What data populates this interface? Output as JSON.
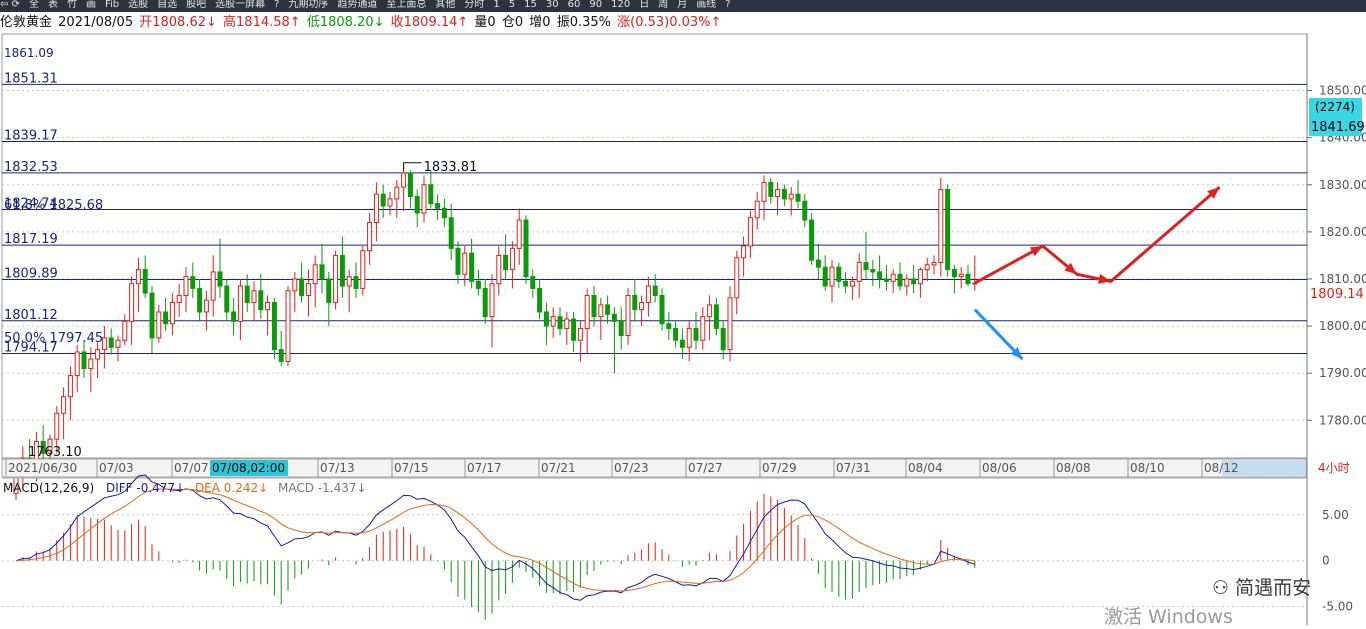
{
  "toolbar": {
    "items": [
      "⇦ ⟳",
      "全",
      "表",
      "竹",
      "画",
      "Fib",
      "选股",
      "自选",
      "股吧",
      "选股一屏幕",
      "?",
      "九期功序",
      "趋势通道",
      "至上面总",
      "其他",
      "分时",
      "1",
      "5",
      "15",
      "30",
      "60",
      "90",
      "120",
      "日",
      "周",
      "月",
      "画线",
      "?"
    ]
  },
  "info": {
    "symbol": "伦敦黄金",
    "date": "2021/08/05",
    "open": "开1808.62↓",
    "high": "高1814.58↑",
    "low": "低1808.20↓",
    "close": "收1809.14↑",
    "volume": "量0",
    "position": "仓0",
    "increase": "增0",
    "amplitude": "振0.35%",
    "change": "涨(0.53)0.03%↑"
  },
  "right_panel": {
    "count_label": "(2274)",
    "last_price_label": "1841.69",
    "current_price_label": "1809.14",
    "period_label": "4小时"
  },
  "chart_data": {
    "type": "candlestick",
    "instrument": "伦敦黄金",
    "timeframe": "4小时",
    "y_axis": {
      "ticks": [
        1780,
        1790,
        1800,
        1810,
        1820,
        1830,
        1840,
        1850
      ],
      "labels": [
        "1780.00",
        "1790.00",
        "1800.00",
        "1810.00",
        "1820.00",
        "1830.00",
        "1840.00",
        "1850.00"
      ],
      "ylim": [
        1772,
        1862
      ]
    },
    "x_axis": {
      "labels": [
        "2021/06/30",
        "07/03",
        "07/07",
        "07/13",
        "07/15",
        "07/17",
        "07/21",
        "07/23",
        "07/27",
        "07/29",
        "07/31",
        "08/04",
        "08/06",
        "08/08",
        "08/10",
        "08/12"
      ],
      "highlight": "07/08,02:00"
    },
    "top_cut_label": "1861.09",
    "horizontal_levels": [
      {
        "value": 1851.31,
        "label": "1851.31"
      },
      {
        "value": 1839.17,
        "label": "1839.17"
      },
      {
        "value": 1832.53,
        "label": "1832.53"
      },
      {
        "value": 1824.74,
        "label": "1824.74"
      },
      {
        "value": 1817.19,
        "label": "1817.19"
      },
      {
        "value": 1809.89,
        "label": "1809.89"
      },
      {
        "value": 1801.12,
        "label": "1801.12"
      },
      {
        "value": 1794.17,
        "label": "1794.17"
      }
    ],
    "fib_labels": [
      {
        "value": 1825.68,
        "label": "61.8% 1825.68"
      },
      {
        "value": 1797.45,
        "label": "50.0% 1797.45"
      }
    ],
    "annotations": [
      {
        "label": "1833.81",
        "value": 1833.81
      },
      {
        "label": "1763.10",
        "value": 1763.1
      }
    ],
    "candles": [
      [
        1764.5,
        1763.1,
        1770.0,
        1769.0
      ],
      [
        1769.0,
        1766.0,
        1774.5,
        1772.0
      ],
      [
        1772.0,
        1768.5,
        1776.0,
        1770.0
      ],
      [
        1770.0,
        1767.0,
        1777.5,
        1775.5
      ],
      [
        1775.5,
        1771.0,
        1779.0,
        1773.0
      ],
      [
        1773.0,
        1770.0,
        1777.0,
        1776.0
      ],
      [
        1776.0,
        1773.0,
        1783.0,
        1781.5
      ],
      [
        1781.5,
        1776.0,
        1787.0,
        1785.0
      ],
      [
        1785.0,
        1780.0,
        1791.5,
        1789.5
      ],
      [
        1789.5,
        1786.0,
        1796.0,
        1794.5
      ],
      [
        1794.5,
        1789.0,
        1797.0,
        1791.0
      ],
      [
        1791.0,
        1786.0,
        1795.5,
        1793.0
      ],
      [
        1793.0,
        1789.0,
        1796.5,
        1795.0
      ],
      [
        1795.0,
        1791.0,
        1800.0,
        1797.5
      ],
      [
        1797.5,
        1794.0,
        1799.5,
        1795.5
      ],
      [
        1795.5,
        1792.5,
        1798.0,
        1797.0
      ],
      [
        1797.0,
        1796.0,
        1802.5,
        1801.0
      ],
      [
        1801.0,
        1796.0,
        1810.5,
        1809.0
      ],
      [
        1809.0,
        1803.0,
        1814.5,
        1812.0
      ],
      [
        1812.0,
        1806.0,
        1815.0,
        1807.0
      ],
      [
        1807.0,
        1794.0,
        1808.5,
        1797.5
      ],
      [
        1797.5,
        1796.5,
        1804.5,
        1803.0
      ],
      [
        1803.0,
        1799.0,
        1806.0,
        1800.5
      ],
      [
        1800.5,
        1798.0,
        1807.0,
        1805.0
      ],
      [
        1805.0,
        1802.0,
        1809.0,
        1806.5
      ],
      [
        1806.5,
        1803.0,
        1812.5,
        1810.5
      ],
      [
        1810.5,
        1806.0,
        1813.5,
        1808.0
      ],
      [
        1808.0,
        1801.0,
        1810.0,
        1803.0
      ],
      [
        1803.0,
        1799.0,
        1807.5,
        1805.5
      ],
      [
        1805.5,
        1802.0,
        1815.0,
        1811.5
      ],
      [
        1811.5,
        1806.0,
        1818.5,
        1808.5
      ],
      [
        1808.5,
        1801.0,
        1810.0,
        1803.0
      ],
      [
        1803.0,
        1798.0,
        1806.0,
        1801.0
      ],
      [
        1801.0,
        1797.0,
        1810.0,
        1808.5
      ],
      [
        1808.5,
        1803.0,
        1811.0,
        1805.0
      ],
      [
        1805.0,
        1801.0,
        1809.5,
        1807.5
      ],
      [
        1807.5,
        1801.5,
        1811.0,
        1803.5
      ],
      [
        1803.5,
        1798.0,
        1806.5,
        1805.0
      ],
      [
        1805.0,
        1793.0,
        1806.0,
        1795.0
      ],
      [
        1795.0,
        1791.5,
        1799.0,
        1792.5
      ],
      [
        1792.5,
        1791.5,
        1808.5,
        1807.5
      ],
      [
        1807.5,
        1803.0,
        1811.5,
        1810.0
      ],
      [
        1810.0,
        1805.0,
        1813.5,
        1806.5
      ],
      [
        1806.5,
        1802.0,
        1812.0,
        1809.0
      ],
      [
        1809.0,
        1804.0,
        1815.0,
        1813.0
      ],
      [
        1813.0,
        1807.0,
        1817.5,
        1810.0
      ],
      [
        1810.0,
        1800.0,
        1811.5,
        1805.0
      ],
      [
        1805.0,
        1803.5,
        1816.0,
        1815.0
      ],
      [
        1815.0,
        1806.0,
        1819.0,
        1808.5
      ],
      [
        1808.5,
        1803.0,
        1812.0,
        1810.5
      ],
      [
        1810.5,
        1806.0,
        1813.5,
        1808.0
      ],
      [
        1808.0,
        1806.5,
        1817.0,
        1816.0
      ],
      [
        1816.0,
        1813.0,
        1824.0,
        1822.0
      ],
      [
        1822.0,
        1818.0,
        1830.5,
        1828.0
      ],
      [
        1828.0,
        1823.0,
        1830.0,
        1825.5
      ],
      [
        1825.5,
        1823.5,
        1828.5,
        1827.0
      ],
      [
        1827.0,
        1823.0,
        1831.0,
        1829.5
      ],
      [
        1829.5,
        1824.5,
        1833.81,
        1832.5
      ],
      [
        1832.5,
        1825.0,
        1833.0,
        1827.5
      ],
      [
        1827.5,
        1821.0,
        1829.0,
        1824.0
      ],
      [
        1824.0,
        1822.0,
        1832.0,
        1830.0
      ],
      [
        1830.0,
        1825.0,
        1833.0,
        1826.0
      ],
      [
        1826.0,
        1822.5,
        1828.0,
        1825.0
      ],
      [
        1825.0,
        1821.0,
        1827.0,
        1823.0
      ],
      [
        1823.0,
        1814.0,
        1826.0,
        1816.5
      ],
      [
        1816.5,
        1809.0,
        1818.0,
        1811.0
      ],
      [
        1811.0,
        1808.5,
        1817.0,
        1815.5
      ],
      [
        1815.5,
        1808.0,
        1818.5,
        1809.5
      ],
      [
        1809.5,
        1806.5,
        1812.0,
        1808.0
      ],
      [
        1808.0,
        1800.5,
        1810.0,
        1802.0
      ],
      [
        1802.0,
        1795.5,
        1811.0,
        1809.0
      ],
      [
        1809.0,
        1806.5,
        1817.0,
        1815.0
      ],
      [
        1815.0,
        1810.0,
        1819.5,
        1812.0
      ],
      [
        1812.0,
        1808.0,
        1818.0,
        1816.5
      ],
      [
        1816.5,
        1813.0,
        1825.0,
        1822.5
      ],
      [
        1822.5,
        1809.0,
        1823.5,
        1810.5
      ],
      [
        1810.5,
        1806.0,
        1812.0,
        1808.0
      ],
      [
        1808.0,
        1801.5,
        1810.0,
        1803.0
      ],
      [
        1803.0,
        1796.0,
        1805.0,
        1800.0
      ],
      [
        1800.0,
        1797.5,
        1804.0,
        1802.0
      ],
      [
        1802.0,
        1798.0,
        1804.0,
        1799.5
      ],
      [
        1799.5,
        1796.0,
        1803.0,
        1801.5
      ],
      [
        1801.5,
        1794.5,
        1803.0,
        1797.0
      ],
      [
        1797.0,
        1792.5,
        1801.0,
        1799.5
      ],
      [
        1799.5,
        1794.0,
        1808.0,
        1806.5
      ],
      [
        1806.5,
        1800.0,
        1808.5,
        1802.0
      ],
      [
        1802.0,
        1797.0,
        1806.0,
        1804.5
      ],
      [
        1804.5,
        1800.5,
        1806.5,
        1802.5
      ],
      [
        1802.5,
        1790.0,
        1804.0,
        1801.0
      ],
      [
        1801.0,
        1795.0,
        1804.0,
        1798.0
      ],
      [
        1798.0,
        1796.0,
        1808.0,
        1806.5
      ],
      [
        1806.5,
        1801.0,
        1810.0,
        1803.5
      ],
      [
        1803.5,
        1800.0,
        1806.5,
        1805.0
      ],
      [
        1805.0,
        1802.0,
        1810.5,
        1808.5
      ],
      [
        1808.5,
        1805.0,
        1811.0,
        1806.5
      ],
      [
        1806.5,
        1799.0,
        1808.0,
        1800.5
      ],
      [
        1800.5,
        1797.0,
        1803.0,
        1799.5
      ],
      [
        1799.5,
        1795.5,
        1801.0,
        1797.0
      ],
      [
        1797.0,
        1793.0,
        1799.5,
        1795.5
      ],
      [
        1795.5,
        1792.5,
        1801.0,
        1799.5
      ],
      [
        1799.5,
        1795.0,
        1803.0,
        1797.0
      ],
      [
        1797.0,
        1795.0,
        1804.0,
        1802.0
      ],
      [
        1802.0,
        1797.0,
        1806.5,
        1804.5
      ],
      [
        1804.5,
        1798.0,
        1806.0,
        1799.5
      ],
      [
        1799.5,
        1793.0,
        1801.0,
        1795.0
      ],
      [
        1795.0,
        1792.5,
        1808.5,
        1806.0
      ],
      [
        1806.0,
        1802.5,
        1816.0,
        1814.5
      ],
      [
        1814.5,
        1810.5,
        1819.0,
        1817.0
      ],
      [
        1817.0,
        1814.5,
        1824.5,
        1823.0
      ],
      [
        1823.0,
        1820.5,
        1828.5,
        1826.5
      ],
      [
        1826.5,
        1822.5,
        1832.0,
        1830.5
      ],
      [
        1830.5,
        1826.0,
        1831.5,
        1827.5
      ],
      [
        1827.5,
        1823.5,
        1830.5,
        1829.0
      ],
      [
        1829.0,
        1825.5,
        1830.0,
        1827.0
      ],
      [
        1827.0,
        1823.5,
        1829.5,
        1828.0
      ],
      [
        1828.0,
        1825.0,
        1831.0,
        1826.5
      ],
      [
        1826.5,
        1821.0,
        1828.0,
        1822.5
      ],
      [
        1822.5,
        1813.0,
        1824.0,
        1814.0
      ],
      [
        1814.0,
        1810.0,
        1817.5,
        1812.5
      ],
      [
        1812.5,
        1807.5,
        1815.0,
        1808.5
      ],
      [
        1808.5,
        1805.0,
        1814.0,
        1812.5
      ],
      [
        1812.5,
        1808.0,
        1813.5,
        1809.5
      ],
      [
        1809.5,
        1807.0,
        1811.5,
        1808.5
      ],
      [
        1808.5,
        1805.5,
        1810.5,
        1809.5
      ],
      [
        1809.5,
        1806.0,
        1815.5,
        1813.5
      ],
      [
        1813.5,
        1810.0,
        1820.0,
        1812.0
      ],
      [
        1812.0,
        1808.5,
        1814.0,
        1811.5
      ],
      [
        1811.5,
        1808.0,
        1815.0,
        1810.0
      ],
      [
        1810.0,
        1807.5,
        1813.0,
        1809.5
      ],
      [
        1809.5,
        1807.0,
        1812.0,
        1811.0
      ],
      [
        1811.0,
        1807.5,
        1813.5,
        1808.5
      ],
      [
        1808.5,
        1806.5,
        1811.0,
        1810.0
      ],
      [
        1810.0,
        1807.0,
        1813.0,
        1809.0
      ],
      [
        1809.0,
        1806.0,
        1812.5,
        1812.0
      ],
      [
        1812.0,
        1809.5,
        1814.5,
        1813.0
      ],
      [
        1813.0,
        1811.0,
        1815.0,
        1813.5
      ],
      [
        1813.5,
        1810.5,
        1831.5,
        1829.0
      ],
      [
        1829.0,
        1810.5,
        1830.0,
        1812.0
      ],
      [
        1812.0,
        1807.0,
        1813.0,
        1810.5
      ],
      [
        1810.5,
        1808.0,
        1812.5,
        1811.0
      ],
      [
        1811.0,
        1808.5,
        1813.0,
        1809.0
      ],
      [
        1809.0,
        1807.5,
        1815.0,
        1809.14
      ]
    ],
    "projection": {
      "red_path": [
        [
          0,
          1809.14
        ],
        [
          10,
          1817.0
        ],
        [
          15,
          1811.0
        ],
        [
          20,
          1809.5
        ],
        [
          36,
          1829.5
        ]
      ],
      "blue_path": [
        [
          0,
          1803.5
        ],
        [
          7,
          1793.0
        ]
      ]
    },
    "macd": {
      "title": "MACD(12,26,9)",
      "diff_label": "DIFF -0.477↓",
      "dea_label": "DEA 0.242↓",
      "macd_label": "MACD -1.437↓",
      "y_ticks": [
        5,
        0,
        -5
      ],
      "y_tick_labels": [
        "5.00",
        "0",
        "-5.00"
      ],
      "ylim": [
        -7,
        9
      ]
    }
  },
  "watermark": {
    "brand": "简遇而安",
    "brand_icon": "weibo-icon",
    "activate": "激活 Windows"
  },
  "colors": {
    "up": "#e0201b",
    "down": "#0a9a0a",
    "level_line": "#1a237e",
    "axis_text": "#555555",
    "highlight_bg": "#27c6d8",
    "projection_up": "#e0201b",
    "projection_down": "#1e90ff"
  }
}
